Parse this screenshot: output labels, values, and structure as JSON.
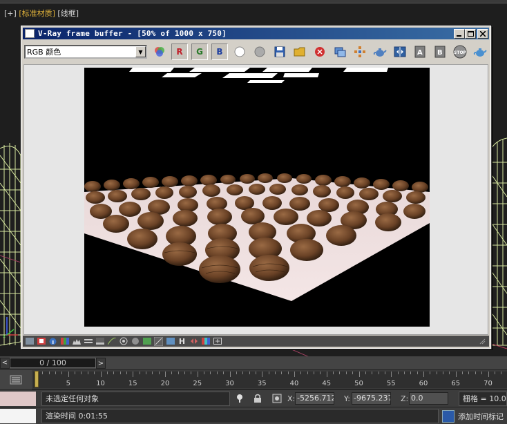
{
  "viewport": {
    "label_plus": "[+]",
    "label_shading": "[标准材质]",
    "label_mode": "[线框]"
  },
  "vfb": {
    "title": "V-Ray frame buffer - [50% of 1000 x 750]",
    "channel": "RGB 颜色",
    "btn_r": "R",
    "btn_g": "G",
    "btn_b": "B",
    "btn_stop": "STOP",
    "status_h": "H"
  },
  "timeline": {
    "frame_display": "0 / 100",
    "prev": "<",
    "next": ">",
    "ticks": [
      "5",
      "10",
      "15",
      "20",
      "25",
      "30",
      "35",
      "40",
      "45",
      "50",
      "55",
      "60",
      "65",
      "70"
    ]
  },
  "status": {
    "selection_prompt": "未选定任何对象",
    "render_time": "渲染时间  0:01:55",
    "x_label": "X:",
    "x_value": "-5256.712",
    "y_label": "Y:",
    "y_value": "-9675.237",
    "z_label": "Z:",
    "z_value": "0.0",
    "grid": "栅格 = 10.0",
    "add_time_tag": "添加时间标记"
  },
  "colors": {
    "title_bar": "#0a246a",
    "red_channel": "#c0202a",
    "green_channel": "#2a7a2a",
    "blue_channel": "#2040a0",
    "playhead": "#c8b050"
  }
}
